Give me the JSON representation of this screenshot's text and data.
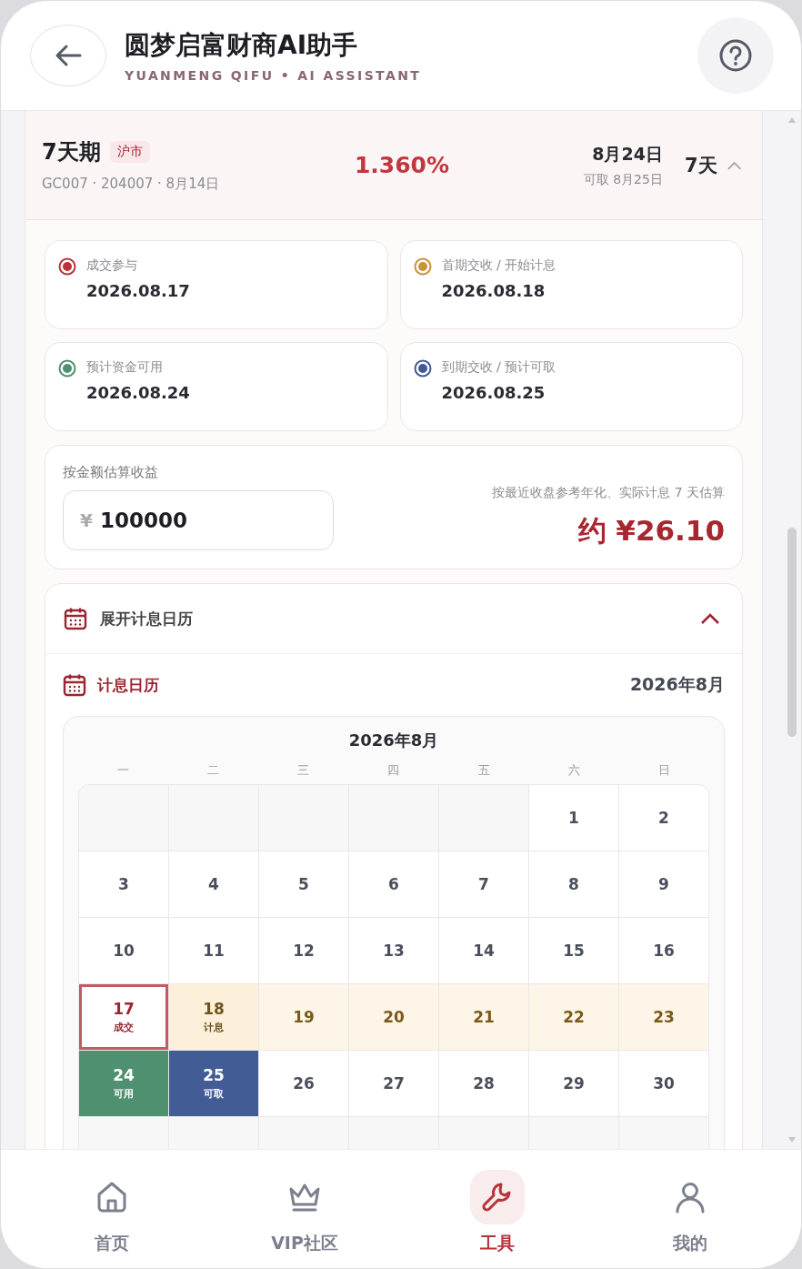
{
  "header": {
    "title": "圆梦启富财商AI助手",
    "subtitle": "YUANMENG QIFU • AI ASSISTANT"
  },
  "product": {
    "name": "7天期",
    "market": "沪市",
    "codes": "GC007 · 204007 · 8月14日",
    "rate": "1.360%",
    "due": "8月24日",
    "withdraw": "可取 8月25日",
    "term": "7天",
    "expanded": true
  },
  "milestones": [
    {
      "label": "成交参与",
      "date": "2026.08.17",
      "color": "#b8323a"
    },
    {
      "label": "首期交收 / 开始计息",
      "date": "2026.08.18",
      "color": "#c8913a"
    },
    {
      "label": "预计资金可用",
      "date": "2026.08.24",
      "color": "#4e9070"
    },
    {
      "label": "到期交收 / 预计可取",
      "date": "2026.08.25",
      "color": "#3f5a96"
    }
  ],
  "estimate": {
    "label": "按金额估算收益",
    "currency": "¥",
    "amount": "100000",
    "note": "按最近收盘参考年化、实际计息 7 天估算",
    "result": "约 ¥26.10"
  },
  "calendar_panel": {
    "toggle": "展开计息日历",
    "expanded": true,
    "title": "计息日历",
    "month": "2026年8月",
    "grid_title": "2026年8月",
    "weekdays": [
      "一",
      "二",
      "三",
      "四",
      "五",
      "六",
      "日"
    ],
    "days": [
      {
        "kind": "empty"
      },
      {
        "kind": "empty"
      },
      {
        "kind": "empty"
      },
      {
        "kind": "empty"
      },
      {
        "kind": "empty"
      },
      {
        "kind": "normal",
        "day": "1"
      },
      {
        "kind": "normal",
        "day": "2"
      },
      {
        "kind": "normal",
        "day": "3"
      },
      {
        "kind": "normal",
        "day": "4"
      },
      {
        "kind": "normal",
        "day": "5"
      },
      {
        "kind": "normal",
        "day": "6"
      },
      {
        "kind": "normal",
        "day": "7"
      },
      {
        "kind": "normal",
        "day": "8"
      },
      {
        "kind": "normal",
        "day": "9"
      },
      {
        "kind": "normal",
        "day": "10"
      },
      {
        "kind": "normal",
        "day": "11"
      },
      {
        "kind": "normal",
        "day": "12"
      },
      {
        "kind": "normal",
        "day": "13"
      },
      {
        "kind": "normal",
        "day": "14"
      },
      {
        "kind": "normal",
        "day": "15"
      },
      {
        "kind": "normal",
        "day": "16"
      },
      {
        "kind": "trade",
        "day": "17",
        "note": "成交"
      },
      {
        "kind": "accrue-start",
        "day": "18",
        "note": "计息"
      },
      {
        "kind": "accrue",
        "day": "19"
      },
      {
        "kind": "accrue",
        "day": "20"
      },
      {
        "kind": "accrue",
        "day": "21"
      },
      {
        "kind": "accrue",
        "day": "22"
      },
      {
        "kind": "accrue",
        "day": "23"
      },
      {
        "kind": "available",
        "day": "24",
        "note": "可用"
      },
      {
        "kind": "withdraw",
        "day": "25",
        "note": "可取"
      },
      {
        "kind": "normal",
        "day": "26"
      },
      {
        "kind": "normal",
        "day": "27"
      },
      {
        "kind": "normal",
        "day": "28"
      },
      {
        "kind": "normal",
        "day": "29"
      },
      {
        "kind": "normal",
        "day": "30"
      },
      {
        "kind": "empty"
      },
      {
        "kind": "empty"
      },
      {
        "kind": "empty"
      },
      {
        "kind": "empty"
      },
      {
        "kind": "empty"
      },
      {
        "kind": "empty"
      },
      {
        "kind": "empty"
      }
    ]
  },
  "nav": [
    {
      "label": "首页",
      "selected": false
    },
    {
      "label": "VIP社区",
      "selected": false
    },
    {
      "label": "工具",
      "selected": true
    },
    {
      "label": "我的",
      "selected": false
    }
  ]
}
